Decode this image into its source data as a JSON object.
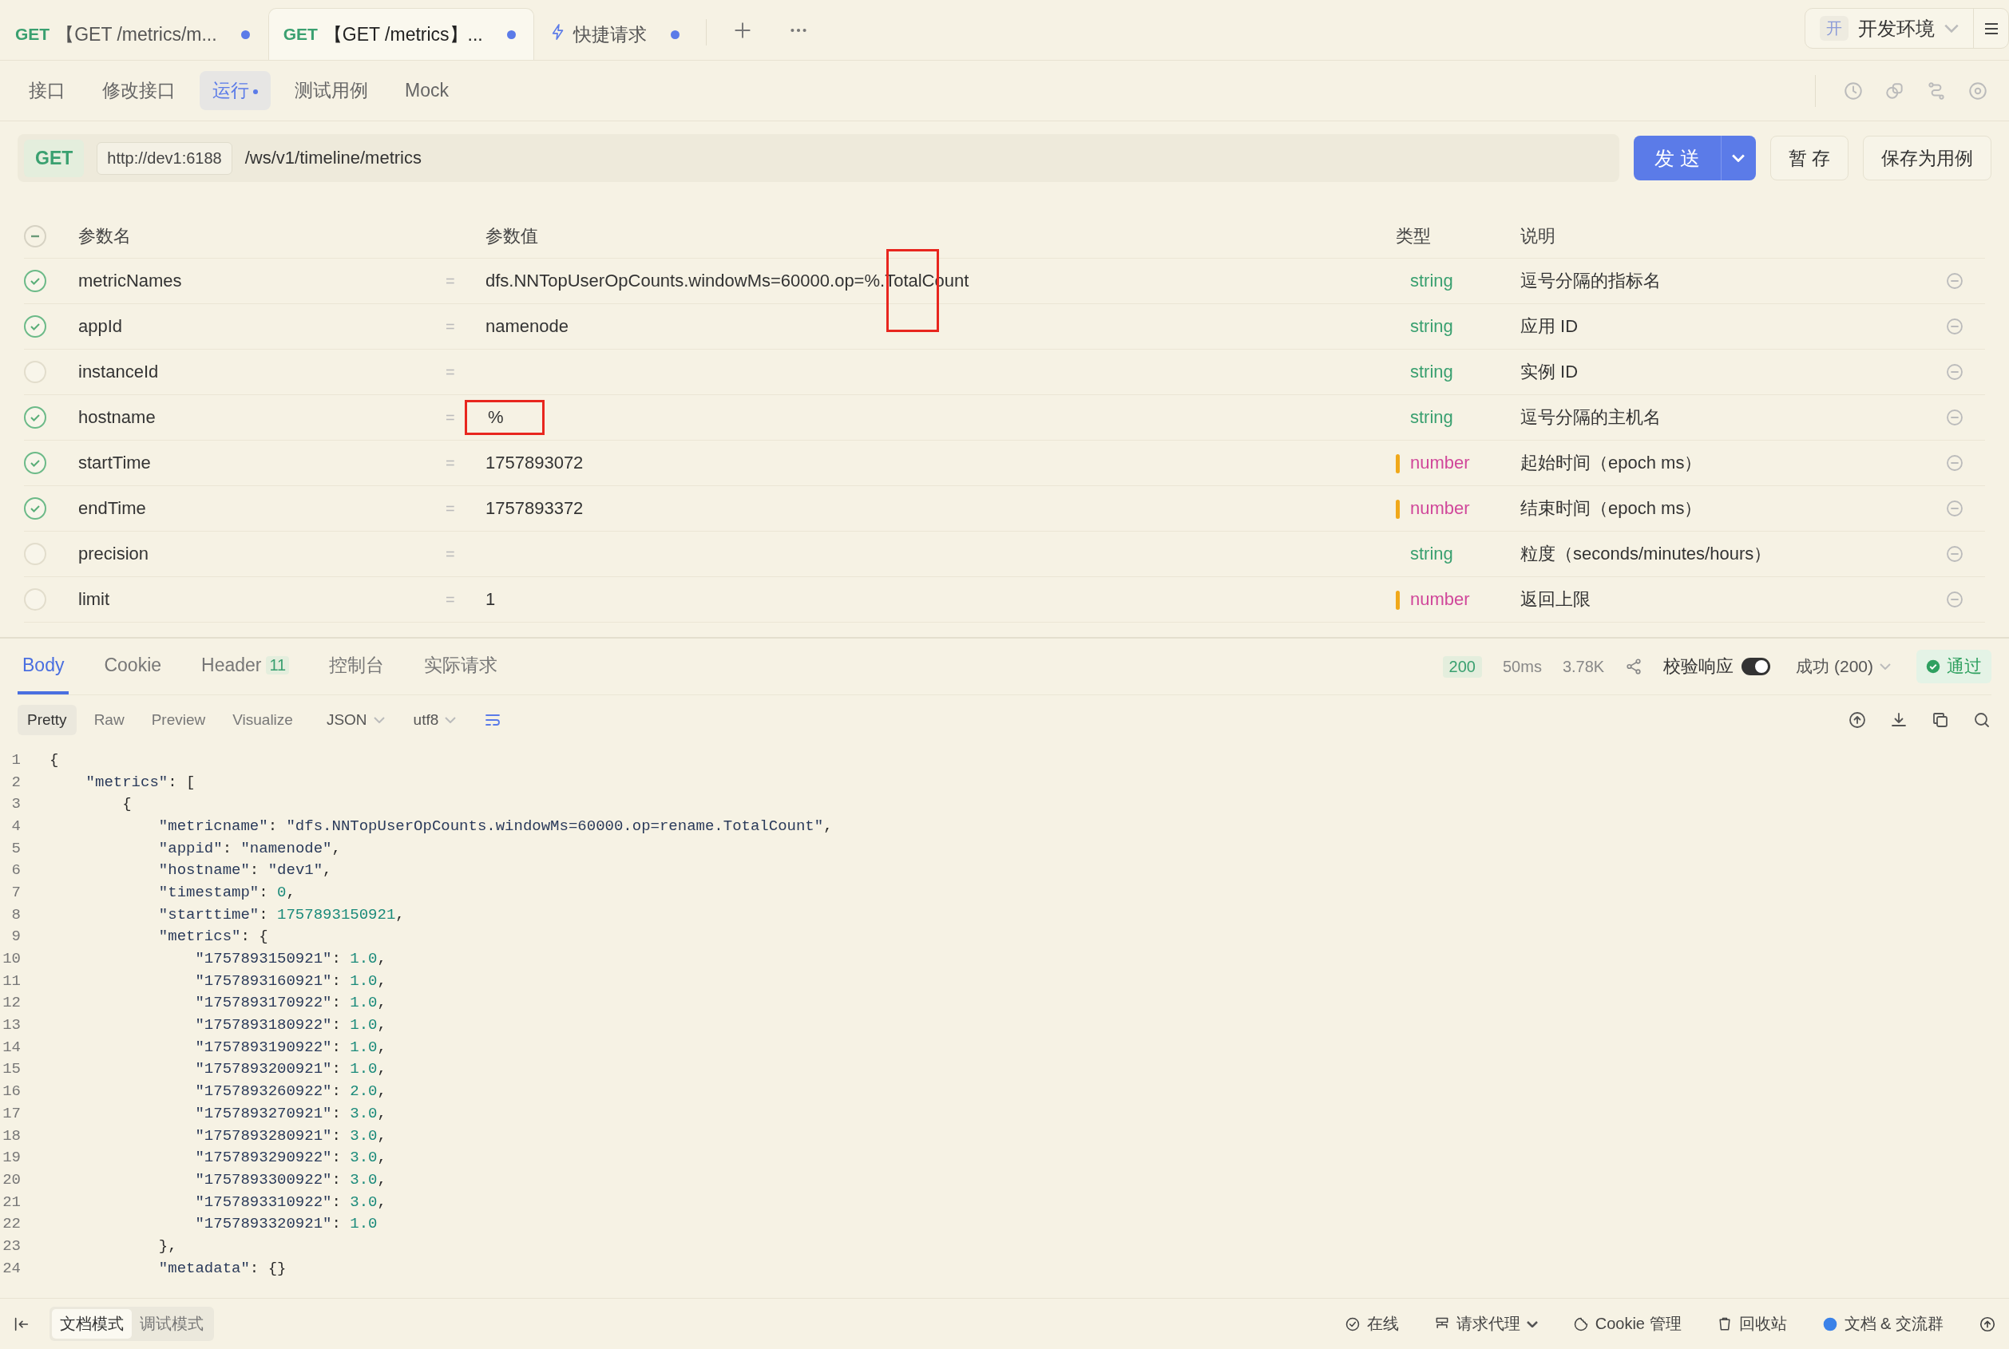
{
  "tabs": [
    {
      "kind": "request",
      "method": "GET",
      "title": "【GET /metrics/m...",
      "selected": false,
      "modified": true
    },
    {
      "kind": "request",
      "method": "GET",
      "title": "【GET /metrics】...",
      "selected": true,
      "modified": true
    },
    {
      "kind": "quick",
      "title": "快捷请求",
      "selected": false,
      "modified": true
    }
  ],
  "environment": {
    "badge": "开",
    "name": "开发环境"
  },
  "subtabs": [
    {
      "label": "接口",
      "selected": false,
      "modified": false
    },
    {
      "label": "修改接口",
      "selected": false,
      "modified": false
    },
    {
      "label": "运行",
      "selected": true,
      "modified": true
    },
    {
      "label": "测试用例",
      "selected": false,
      "modified": false
    },
    {
      "label": "Mock",
      "selected": false,
      "modified": false
    }
  ],
  "request": {
    "method": "GET",
    "base_url": "http://dev1:6188",
    "path": "/ws/v1/timeline/metrics",
    "send": "发 送",
    "save": "暂 存",
    "save_as_case": "保存为用例"
  },
  "params": {
    "columns": [
      "参数名",
      "参数值",
      "类型",
      "说明"
    ],
    "select_all_partial": true,
    "separators": [
      "=",
      "=",
      "=",
      "=",
      "=",
      "=",
      "=",
      "="
    ],
    "rows": [
      {
        "name": "metricNames",
        "value": "dfs.NNTopUserOpCounts.windowMs=60000.op=%.TotalCount",
        "type": "string",
        "description": "逗号分隔的指标名",
        "checked": true,
        "flagged": false,
        "highlighted": true
      },
      {
        "name": "appId",
        "value": "namenode",
        "type": "string",
        "description": "应用 ID",
        "checked": true,
        "flagged": false,
        "highlighted": false
      },
      {
        "name": "instanceId",
        "value": "",
        "type": "string",
        "description": "实例 ID",
        "checked": false,
        "flagged": false,
        "highlighted": false
      },
      {
        "name": "hostname",
        "value": "%",
        "type": "string",
        "description": "逗号分隔的主机名",
        "checked": true,
        "flagged": false,
        "highlighted": true
      },
      {
        "name": "startTime",
        "value": "1757893072",
        "type": "number",
        "description": "起始时间（epoch ms）",
        "checked": true,
        "flagged": true,
        "highlighted": false
      },
      {
        "name": "endTime",
        "value": "1757893372",
        "type": "number",
        "description": "结束时间（epoch ms）",
        "checked": true,
        "flagged": true,
        "highlighted": false
      },
      {
        "name": "precision",
        "value": "",
        "type": "string",
        "description": "粒度（seconds/minutes/hours）",
        "checked": false,
        "flagged": false,
        "highlighted": false
      },
      {
        "name": "limit",
        "value": "1",
        "type": "number",
        "description": "返回上限",
        "checked": false,
        "flagged": true,
        "highlighted": false
      }
    ]
  },
  "response": {
    "tabs": [
      {
        "label": "Body",
        "selected": true
      },
      {
        "label": "Cookie",
        "selected": false
      },
      {
        "label": "Header",
        "count": "11",
        "selected": false
      },
      {
        "label": "控制台",
        "selected": false
      },
      {
        "label": "实际请求",
        "selected": false
      }
    ],
    "status": "200",
    "time": "50ms",
    "size": "3.78K",
    "validate_label": "校验响应",
    "validate_on": true,
    "expected": "成功 (200)",
    "result": "通过",
    "views": [
      {
        "label": "Pretty",
        "selected": true
      },
      {
        "label": "Raw",
        "selected": false
      },
      {
        "label": "Preview",
        "selected": false
      },
      {
        "label": "Visualize",
        "selected": false
      }
    ],
    "format": "JSON",
    "encoding": "utf8",
    "line_numbers": [
      "1",
      "2",
      "3",
      "4",
      "5",
      "6",
      "7",
      "8",
      "9",
      "10",
      "11",
      "12",
      "13",
      "14",
      "15",
      "16",
      "17",
      "18",
      "19",
      "20",
      "21",
      "22",
      "23",
      "24"
    ],
    "lines": [
      "{",
      "    \"metrics\": [",
      "        {",
      "            \"metricname\": \"dfs.NNTopUserOpCounts.windowMs=60000.op=rename.TotalCount\",",
      "            \"appid\": \"namenode\",",
      "            \"hostname\": \"dev1\",",
      "            \"timestamp\": 0,",
      "            \"starttime\": 1757893150921,",
      "            \"metrics\": {",
      "                \"1757893150921\": 1.0,",
      "                \"1757893160921\": 1.0,",
      "                \"1757893170922\": 1.0,",
      "                \"1757893180922\": 1.0,",
      "                \"1757893190922\": 1.0,",
      "                \"1757893200921\": 1.0,",
      "                \"1757893260922\": 2.0,",
      "                \"1757893270921\": 3.0,",
      "                \"1757893280921\": 3.0,",
      "                \"1757893290922\": 3.0,",
      "                \"1757893300922\": 3.0,",
      "                \"1757893310922\": 3.0,",
      "                \"1757893320921\": 1.0",
      "            },",
      "            \"metadata\": {}"
    ]
  },
  "status_bar": {
    "modes": [
      {
        "label": "文档模式",
        "selected": true
      },
      {
        "label": "调试模式",
        "selected": false
      }
    ],
    "items": [
      {
        "kind": "online",
        "label": "在线"
      },
      {
        "kind": "proxy",
        "label": "请求代理"
      },
      {
        "kind": "cookie",
        "label": "Cookie 管理"
      },
      {
        "kind": "trash",
        "label": "回收站"
      },
      {
        "kind": "community",
        "label": "文档 & 交流群"
      }
    ]
  }
}
